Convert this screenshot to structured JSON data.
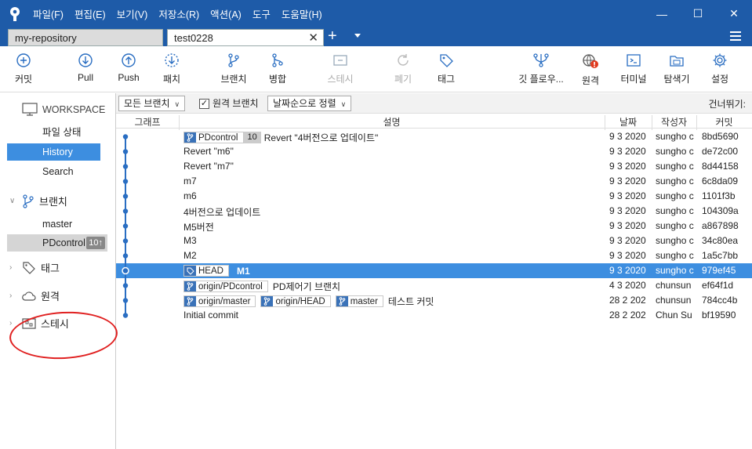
{
  "menu": [
    "파일(F)",
    "편집(E)",
    "보기(V)",
    "저장소(R)",
    "액션(A)",
    "도구",
    "도움말(H)"
  ],
  "tabs": [
    {
      "label": "my-repository"
    },
    {
      "label": "test0228"
    }
  ],
  "toolbar": {
    "commit": "커밋",
    "pull": "Pull",
    "push": "Push",
    "fetch": "패치",
    "branch": "브랜치",
    "merge": "병합",
    "stash": "스테시",
    "discard": "폐기",
    "tag": "태그",
    "gitflow": "깃 플로우...",
    "remote": "원격",
    "terminal": "터미널",
    "explorer": "탐색기",
    "settings": "설정"
  },
  "sidebar": {
    "workspace": "WORKSPACE",
    "file_status": "파일 상태",
    "history": "History",
    "search": "Search",
    "branches": "브랜치",
    "branch_master": "master",
    "branch_pdcontrol": "PDcontrol",
    "branch_pdcontrol_ahead": "10↑",
    "tags": "태그",
    "remotes": "원격",
    "stashes": "스테시"
  },
  "filter": {
    "all_branches": "모든 브랜치",
    "remote_branches": "원격 브랜치",
    "sort": "날짜순으로 정렬",
    "jump_to": "건너뛰기:"
  },
  "columns": {
    "graph": "그래프",
    "description": "설명",
    "date": "날짜",
    "author": "작성자",
    "commit": "커밋"
  },
  "commits": [
    {
      "refs": [
        {
          "type": "branch",
          "name": "PDcontrol",
          "count": "10"
        }
      ],
      "message": "Revert \"4버전으로 업데이트\"",
      "date": "9 3 2020",
      "author": "sungho c",
      "hash": "8bd5690"
    },
    {
      "refs": [],
      "message": "Revert \"m6\"",
      "date": "9 3 2020",
      "author": "sungho c",
      "hash": "de72c00"
    },
    {
      "refs": [],
      "message": "Revert \"m7\"",
      "date": "9 3 2020",
      "author": "sungho c",
      "hash": "8d44158"
    },
    {
      "refs": [],
      "message": "m7",
      "date": "9 3 2020",
      "author": "sungho c",
      "hash": "6c8da09"
    },
    {
      "refs": [],
      "message": "m6",
      "date": "9 3 2020",
      "author": "sungho c",
      "hash": "1101f3b"
    },
    {
      "refs": [],
      "message": "4버전으로 업데이트",
      "date": "9 3 2020",
      "author": "sungho c",
      "hash": "104309a"
    },
    {
      "refs": [],
      "message": "M5버전",
      "date": "9 3 2020",
      "author": "sungho c",
      "hash": "a867898"
    },
    {
      "refs": [],
      "message": "M3",
      "date": "9 3 2020",
      "author": "sungho c",
      "hash": "34c80ea"
    },
    {
      "refs": [],
      "message": "M2",
      "date": "9 3 2020",
      "author": "sungho c",
      "hash": "1a5c7bb"
    },
    {
      "refs": [
        {
          "type": "tag",
          "name": "HEAD"
        }
      ],
      "message": "M1",
      "date": "9 3 2020",
      "author": "sungho c",
      "hash": "979ef45",
      "selected": true
    },
    {
      "refs": [
        {
          "type": "branch",
          "name": "origin/PDcontrol"
        }
      ],
      "message": "PD제어기 브랜치",
      "date": "4 3 2020",
      "author": "chunsun",
      "hash": "ef64f1d"
    },
    {
      "refs": [
        {
          "type": "branch",
          "name": "origin/master"
        },
        {
          "type": "branch",
          "name": "origin/HEAD"
        },
        {
          "type": "branch",
          "name": "master"
        }
      ],
      "message": "테스트 커밋",
      "date": "28 2 202",
      "author": "chunsun",
      "hash": "784cc4b"
    },
    {
      "refs": [],
      "message": "Initial commit",
      "date": "28 2 202",
      "author": "Chun Su",
      "hash": "bf19590"
    }
  ],
  "colors": {
    "titlebar": "#1e5ba8",
    "selection": "#3d8ee0",
    "graph_line": "#2a6ec2",
    "annotation": "#e02020"
  }
}
